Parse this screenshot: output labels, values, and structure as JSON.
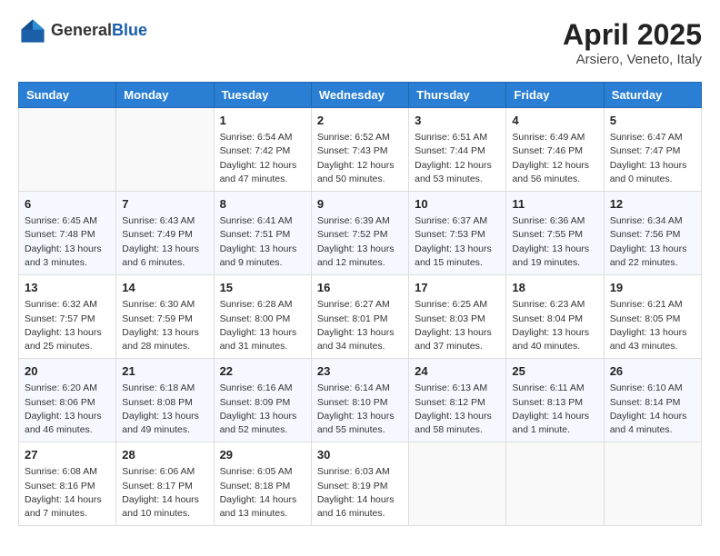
{
  "header": {
    "logo_line1": "General",
    "logo_line2": "Blue",
    "title": "April 2025",
    "subtitle": "Arsiero, Veneto, Italy"
  },
  "weekdays": [
    "Sunday",
    "Monday",
    "Tuesday",
    "Wednesday",
    "Thursday",
    "Friday",
    "Saturday"
  ],
  "weeks": [
    [
      {
        "day": "",
        "info": ""
      },
      {
        "day": "",
        "info": ""
      },
      {
        "day": "1",
        "info": "Sunrise: 6:54 AM\nSunset: 7:42 PM\nDaylight: 12 hours and 47 minutes."
      },
      {
        "day": "2",
        "info": "Sunrise: 6:52 AM\nSunset: 7:43 PM\nDaylight: 12 hours and 50 minutes."
      },
      {
        "day": "3",
        "info": "Sunrise: 6:51 AM\nSunset: 7:44 PM\nDaylight: 12 hours and 53 minutes."
      },
      {
        "day": "4",
        "info": "Sunrise: 6:49 AM\nSunset: 7:46 PM\nDaylight: 12 hours and 56 minutes."
      },
      {
        "day": "5",
        "info": "Sunrise: 6:47 AM\nSunset: 7:47 PM\nDaylight: 13 hours and 0 minutes."
      }
    ],
    [
      {
        "day": "6",
        "info": "Sunrise: 6:45 AM\nSunset: 7:48 PM\nDaylight: 13 hours and 3 minutes."
      },
      {
        "day": "7",
        "info": "Sunrise: 6:43 AM\nSunset: 7:49 PM\nDaylight: 13 hours and 6 minutes."
      },
      {
        "day": "8",
        "info": "Sunrise: 6:41 AM\nSunset: 7:51 PM\nDaylight: 13 hours and 9 minutes."
      },
      {
        "day": "9",
        "info": "Sunrise: 6:39 AM\nSunset: 7:52 PM\nDaylight: 13 hours and 12 minutes."
      },
      {
        "day": "10",
        "info": "Sunrise: 6:37 AM\nSunset: 7:53 PM\nDaylight: 13 hours and 15 minutes."
      },
      {
        "day": "11",
        "info": "Sunrise: 6:36 AM\nSunset: 7:55 PM\nDaylight: 13 hours and 19 minutes."
      },
      {
        "day": "12",
        "info": "Sunrise: 6:34 AM\nSunset: 7:56 PM\nDaylight: 13 hours and 22 minutes."
      }
    ],
    [
      {
        "day": "13",
        "info": "Sunrise: 6:32 AM\nSunset: 7:57 PM\nDaylight: 13 hours and 25 minutes."
      },
      {
        "day": "14",
        "info": "Sunrise: 6:30 AM\nSunset: 7:59 PM\nDaylight: 13 hours and 28 minutes."
      },
      {
        "day": "15",
        "info": "Sunrise: 6:28 AM\nSunset: 8:00 PM\nDaylight: 13 hours and 31 minutes."
      },
      {
        "day": "16",
        "info": "Sunrise: 6:27 AM\nSunset: 8:01 PM\nDaylight: 13 hours and 34 minutes."
      },
      {
        "day": "17",
        "info": "Sunrise: 6:25 AM\nSunset: 8:03 PM\nDaylight: 13 hours and 37 minutes."
      },
      {
        "day": "18",
        "info": "Sunrise: 6:23 AM\nSunset: 8:04 PM\nDaylight: 13 hours and 40 minutes."
      },
      {
        "day": "19",
        "info": "Sunrise: 6:21 AM\nSunset: 8:05 PM\nDaylight: 13 hours and 43 minutes."
      }
    ],
    [
      {
        "day": "20",
        "info": "Sunrise: 6:20 AM\nSunset: 8:06 PM\nDaylight: 13 hours and 46 minutes."
      },
      {
        "day": "21",
        "info": "Sunrise: 6:18 AM\nSunset: 8:08 PM\nDaylight: 13 hours and 49 minutes."
      },
      {
        "day": "22",
        "info": "Sunrise: 6:16 AM\nSunset: 8:09 PM\nDaylight: 13 hours and 52 minutes."
      },
      {
        "day": "23",
        "info": "Sunrise: 6:14 AM\nSunset: 8:10 PM\nDaylight: 13 hours and 55 minutes."
      },
      {
        "day": "24",
        "info": "Sunrise: 6:13 AM\nSunset: 8:12 PM\nDaylight: 13 hours and 58 minutes."
      },
      {
        "day": "25",
        "info": "Sunrise: 6:11 AM\nSunset: 8:13 PM\nDaylight: 14 hours and 1 minute."
      },
      {
        "day": "26",
        "info": "Sunrise: 6:10 AM\nSunset: 8:14 PM\nDaylight: 14 hours and 4 minutes."
      }
    ],
    [
      {
        "day": "27",
        "info": "Sunrise: 6:08 AM\nSunset: 8:16 PM\nDaylight: 14 hours and 7 minutes."
      },
      {
        "day": "28",
        "info": "Sunrise: 6:06 AM\nSunset: 8:17 PM\nDaylight: 14 hours and 10 minutes."
      },
      {
        "day": "29",
        "info": "Sunrise: 6:05 AM\nSunset: 8:18 PM\nDaylight: 14 hours and 13 minutes."
      },
      {
        "day": "30",
        "info": "Sunrise: 6:03 AM\nSunset: 8:19 PM\nDaylight: 14 hours and 16 minutes."
      },
      {
        "day": "",
        "info": ""
      },
      {
        "day": "",
        "info": ""
      },
      {
        "day": "",
        "info": ""
      }
    ]
  ]
}
